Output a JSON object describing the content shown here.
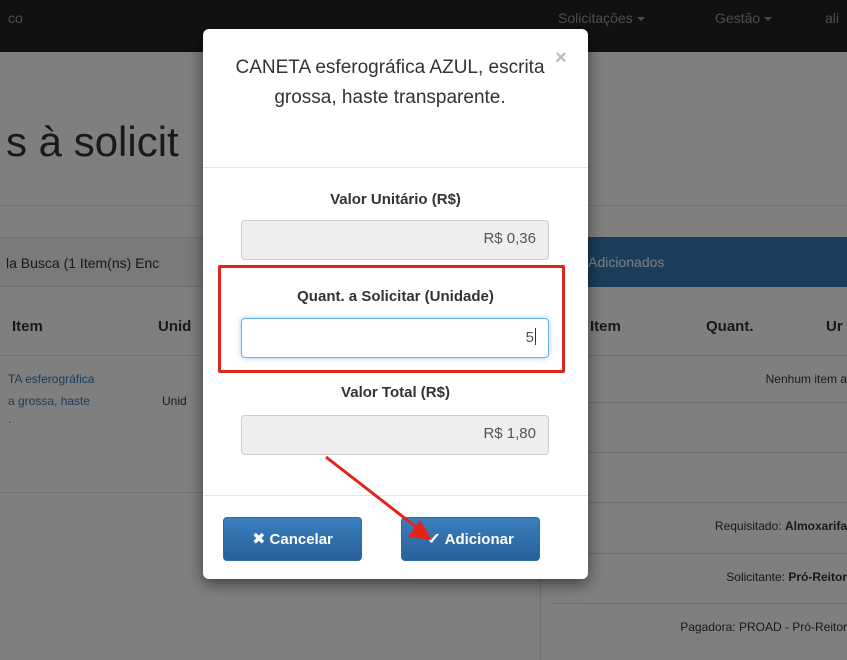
{
  "navbar": {
    "brand": "co",
    "items": [
      {
        "label": "Solicitações"
      },
      {
        "label": "Gestão"
      },
      {
        "label": "ali"
      }
    ]
  },
  "page": {
    "title": "s à solicit",
    "left_panel": {
      "heading": "la Busca (1 Item(ns) Enc",
      "columns": [
        "Item",
        "Unid"
      ],
      "rows": [
        {
          "item_line1": "TA esferográfica",
          "item_line2": "a grossa, haste",
          "item_line3": ".",
          "unit": "Unid"
        }
      ]
    },
    "right_panel": {
      "heading": "s Adicionados",
      "columns": [
        "Item",
        "Quant.",
        "Ur"
      ],
      "empty_message": "Nenhum item a",
      "requisitado_label": "Requisitado:",
      "requisitado_value": "Almoxarifa",
      "solicitante_label": "Solicitante:",
      "solicitante_value": "Pró-Reitor",
      "pagadora_label": "Pagadora:",
      "pagadora_value": "PROAD - Pró-Reitor"
    }
  },
  "modal": {
    "title": "CANETA esferográfica AZUL, escrita grossa, haste transparente.",
    "close_symbol": "×",
    "unit_value_label": "Valor Unitário (R$)",
    "unit_value": "R$ 0,36",
    "quantity_label": "Quant. a Solicitar (Unidade)",
    "quantity_value": "5",
    "total_label": "Valor Total (R$)",
    "total_value": "R$ 1,80",
    "cancel_label": "Cancelar",
    "add_label": "Adicionar"
  },
  "icons": {
    "cancel": "times-icon",
    "add": "check-icon"
  },
  "colors": {
    "primary": "#337ab7",
    "annotation": "#e2231a",
    "navbar": "#222222"
  }
}
